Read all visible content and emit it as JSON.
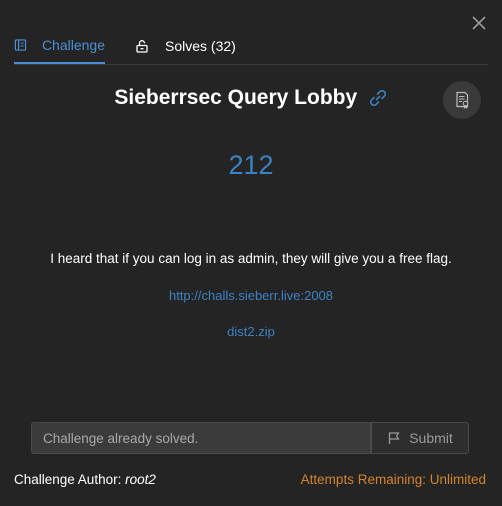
{
  "tabs": {
    "challenge_label": "Challenge",
    "solves_label": "Solves (32)"
  },
  "challenge": {
    "title": "Sieberrsec Query Lobby",
    "points": "212",
    "description": "I heard that if you can log in as admin, they will give you a free flag.",
    "links": [
      {
        "text": "http://challs.sieberr.live:2008"
      },
      {
        "text": "dist2.zip"
      }
    ]
  },
  "submission": {
    "placeholder": "Challenge already solved.",
    "submit_label": "Submit"
  },
  "footer": {
    "author_label": "Challenge Author:",
    "author_name": "root2",
    "attempts_text": "Attempts Remaining: Unlimited"
  },
  "icons": {
    "close": "close-icon",
    "challenge_tab": "book-icon",
    "solves_tab": "unlock-icon",
    "title_link": "link-icon",
    "ticket": "ticket-icon",
    "submit": "flag-icon"
  },
  "colors": {
    "background": "#242424",
    "accent": "#3b82c4",
    "active_tab": "#4a8fd6",
    "attempts": "#d2832f"
  }
}
